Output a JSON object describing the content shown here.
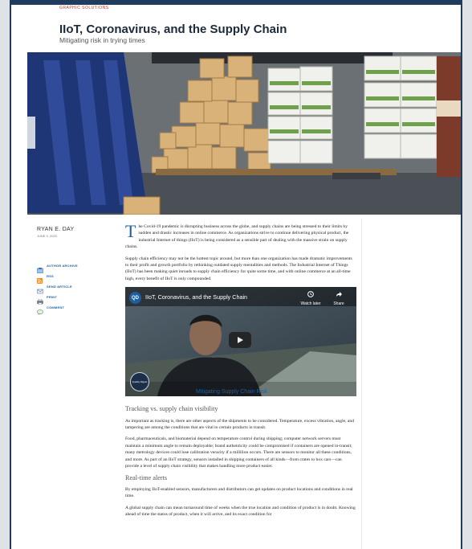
{
  "header": {
    "kicker": "GRAPHIC SOLUTIONS",
    "title": "IIoT, Coronavirus, and the Supply Chain",
    "subtitle": "Mitigating risk in trying times"
  },
  "byline": {
    "author": "RYAN E. DAY",
    "date": "JUNE 3, 2020"
  },
  "tools": [
    {
      "label": "AUTHOR ARCHIVE",
      "icon": "archive-icon"
    },
    {
      "label": "RSS",
      "icon": "rss-icon"
    },
    {
      "label": "SEND ARTICLE",
      "icon": "email-icon"
    },
    {
      "label": "PRINT",
      "icon": "print-icon"
    },
    {
      "label": "COMMENT",
      "icon": "comment-icon"
    }
  ],
  "article": {
    "dropcap": "T",
    "p1": "he Covid-19 pandemic is disrupting business across the globe, and supply chains are being stressed to their limits by sudden and drastic increases in online commerce. As organizations strive to continue delivering physical product, the industrial Internet of things (IIoT) is being considered as a sensible part of dealing with the massive strain on supply chains.",
    "p2": "Supply chain efficiency may not be the hottest topic around, but more than one organization has made dramatic improvements to their profit and growth portfolio by rethinking outdated supply mentalities and methods. The Industrial Internet of Things (IIoT) has been making quiet inroads to supply chain efficiency for quite some time, and with online commerce at an all-time high, every benefit of IIoT is only compounded.",
    "h1": "Tracking vs. supply chain visibility",
    "p3": "As important as tracking is, there are other aspects of the shipments to be considered. Temperature, excess vibration, angle, and tampering are among the conditions that are vital to certain products in transit.",
    "p4": "Food, pharmaceuticals, and biomaterial depend on temperature control during shipping; computer network servers must maintain a minimum angle to remain deployable; brand authenticity could be compromised if containers are opened in-transit; many metrology devices could lose calibration veracity if a millilion occurs. There are sensors to monitor all these conditions, and more. As part of an IIoT strategy, sensors installed in shipping containers of all kinds—from crates to box cars—can provide a level of supply chain visibility that makes handling more product easier.",
    "h2": "Real-time alerts",
    "p5": "By employing IIoT-enabled sensors, manufacturers and distributors can get updates on product locations and conditions in real time.",
    "p6": "A global supply chain can mean turnaround time of weeks when the true location and condition of product is in doubt. Knowing ahead of time the status of product, when it will arrive, and its exact condition for"
  },
  "video": {
    "logo": "QD",
    "title": "IIoT, Coronavirus, and the Supply Chain",
    "watch_later": "Watch later",
    "share": "Share",
    "channel": "Quality Digest",
    "caption": "Mitigating Supply Chain Risk"
  }
}
